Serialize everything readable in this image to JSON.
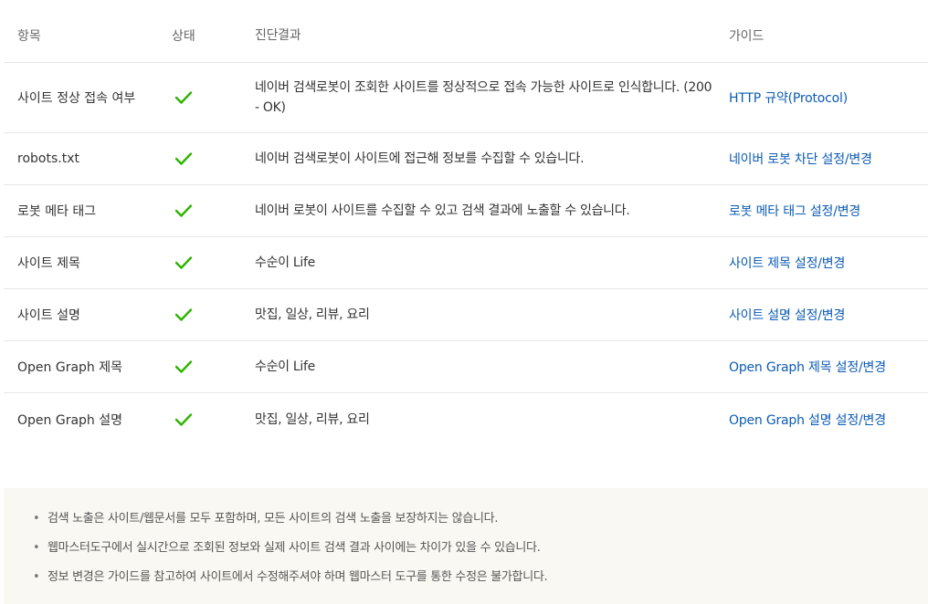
{
  "table": {
    "headers": {
      "item": "항목",
      "status": "상태",
      "result": "진단결과",
      "guide": "가이드"
    },
    "rows": [
      {
        "item": "사이트 정상 접속 여부",
        "status": "ok",
        "result": "네이버 검색로봇이 조회한 사이트를 정상적으로 접속 가능한 사이트로 인식합니다. (200 - OK)",
        "guide": "HTTP 규약(Protocol)"
      },
      {
        "item": "robots.txt",
        "status": "ok",
        "result": "네이버 검색로봇이 사이트에 접근해 정보를 수집할 수 있습니다.",
        "guide": "네이버 로봇 차단 설정/변경"
      },
      {
        "item": "로봇 메타 태그",
        "status": "ok",
        "result": "네이버 로봇이 사이트를 수집할 수 있고 검색 결과에 노출할 수 있습니다.",
        "guide": "로봇 메타 태그 설정/변경"
      },
      {
        "item": "사이트 제목",
        "status": "ok",
        "result": "수순이 Life",
        "guide": "사이트 제목 설정/변경"
      },
      {
        "item": "사이트 설명",
        "status": "ok",
        "result": "맛집, 일상, 리뷰, 요리",
        "guide": "사이트 설명 설정/변경"
      },
      {
        "item": "Open Graph 제목",
        "status": "ok",
        "result": "수순이 Life",
        "guide": "Open Graph 제목 설정/변경"
      },
      {
        "item": "Open Graph 설명",
        "status": "ok",
        "result": "맛집, 일상, 리뷰, 요리",
        "guide": "Open Graph 설명 설정/변경"
      }
    ]
  },
  "notice": {
    "bullet": "•",
    "items": [
      "검색 노출은 사이트/웹문서를 모두 포함하며, 모든 사이트의 검색 노출을 보장하지는 않습니다.",
      "웹마스터도구에서 실시간으로 조회된 정보와 실제 사이트 검색 결과 사이에는 차이가 있을 수 있습니다.",
      "정보 변경은 가이드를 참고하여 사이트에서 수정해주셔야 하며 웹마스터 도구를 통한 수정은 불가합니다."
    ]
  },
  "colors": {
    "check": "#2db400",
    "link": "#0b5bb5",
    "notice_bg": "#f9f8f3",
    "border": "#e6e6e6"
  },
  "icons": {
    "status_ok": "check-icon"
  }
}
